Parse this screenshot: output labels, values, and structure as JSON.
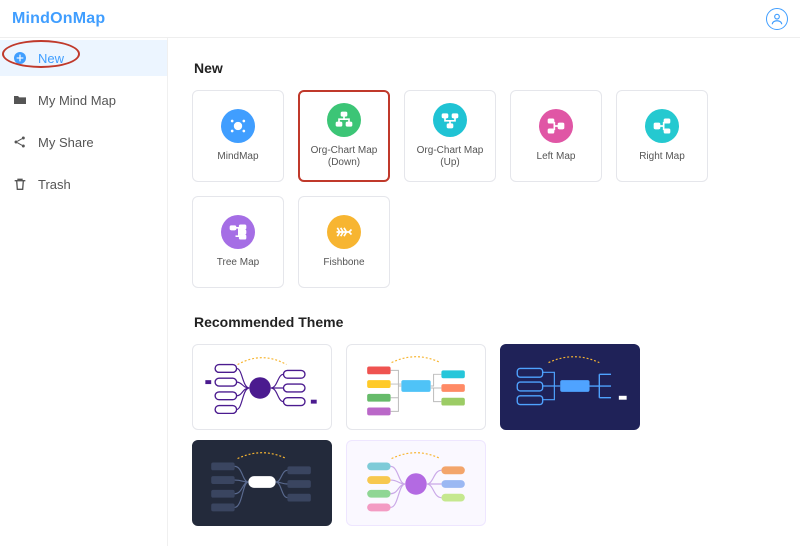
{
  "brand": "MindOnMap",
  "sidebar": {
    "items": [
      {
        "label": "New"
      },
      {
        "label": "My Mind Map"
      },
      {
        "label": "My Share"
      },
      {
        "label": "Trash"
      }
    ]
  },
  "sections": {
    "new_title": "New",
    "themes_title": "Recommended Theme"
  },
  "templates": [
    {
      "label": "MindMap"
    },
    {
      "label": "Org-Chart Map (Down)"
    },
    {
      "label": "Org-Chart Map (Up)"
    },
    {
      "label": "Left Map"
    },
    {
      "label": "Right Map"
    },
    {
      "label": "Tree Map"
    },
    {
      "label": "Fishbone"
    }
  ]
}
